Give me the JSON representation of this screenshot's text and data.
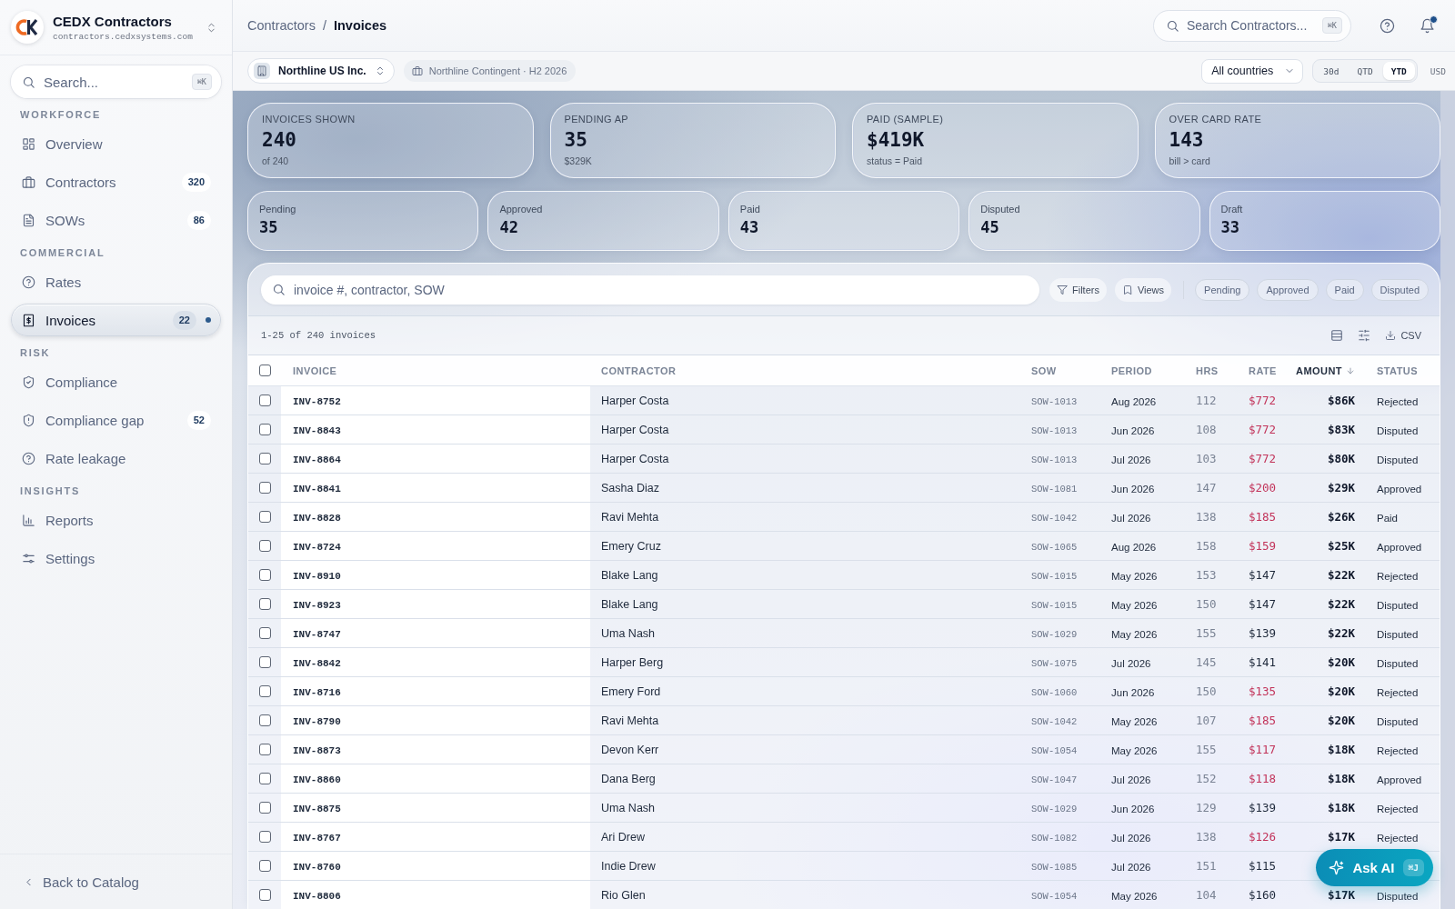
{
  "sidebar": {
    "brand": {
      "name": "CEDX Contractors",
      "domain": "contractors.cedxsystems.com"
    },
    "search": {
      "placeholder": "Search...",
      "shortcut": "⌘K"
    },
    "sections": [
      {
        "label": "WORKFORCE",
        "items": [
          {
            "label": "Overview",
            "selected": false
          },
          {
            "label": "Contractors",
            "badge": "320",
            "selected": false
          },
          {
            "label": "SOWs",
            "badge": "86",
            "selected": false
          }
        ]
      },
      {
        "label": "COMMERCIAL",
        "items": [
          {
            "label": "Rates",
            "selected": false
          },
          {
            "label": "Invoices",
            "badge": "22",
            "selected": true
          }
        ]
      },
      {
        "label": "RISK",
        "items": [
          {
            "label": "Compliance",
            "selected": false
          },
          {
            "label": "Compliance gap",
            "badge": "52",
            "selected": false
          },
          {
            "label": "Rate leakage",
            "selected": false
          }
        ]
      },
      {
        "label": "INSIGHTS",
        "items": [
          {
            "label": "Reports",
            "selected": false
          },
          {
            "label": "Settings",
            "selected": false
          }
        ]
      }
    ],
    "back_link": "Back to Catalog"
  },
  "topbar": {
    "breadcrumb": [
      {
        "label": "Contractors",
        "current": false
      },
      {
        "label": "Invoices",
        "current": true
      }
    ],
    "separator": "/",
    "search": {
      "placeholder": "Search Contractors...",
      "shortcut": "⌘K"
    },
    "notifications": {
      "unread": true
    }
  },
  "filter_bar": {
    "entity": "Northline US Inc.",
    "program": "Northline Contingent · H2 2026",
    "country": "All countries",
    "periods": [
      {
        "label": "30d",
        "selected": false
      },
      {
        "label": "QTD",
        "selected": false
      },
      {
        "label": "YTD",
        "selected": true
      }
    ],
    "currency": "USD"
  },
  "kpis": [
    {
      "label": "INVOICES SHOWN",
      "value": "240",
      "sub": "of 240"
    },
    {
      "label": "PENDING AP",
      "value": "35",
      "sub": "$329K"
    },
    {
      "label": "PAID (SAMPLE)",
      "value": "$419K",
      "sub": "status = Paid"
    },
    {
      "label": "OVER CARD RATE",
      "value": "143",
      "sub": "bill > card"
    }
  ],
  "status_counts": [
    {
      "label": "Pending",
      "value": "35"
    },
    {
      "label": "Approved",
      "value": "42"
    },
    {
      "label": "Paid",
      "value": "43"
    },
    {
      "label": "Disputed",
      "value": "45"
    },
    {
      "label": "Draft",
      "value": "33"
    }
  ],
  "invoices": {
    "search": {
      "placeholder": "invoice #, contractor, SOW"
    },
    "filters_button": "Filters",
    "views_button": "Views",
    "chips": [
      {
        "label": "Pending",
        "selected": false
      },
      {
        "label": "Approved",
        "selected": false
      },
      {
        "label": "Paid",
        "selected": false
      },
      {
        "label": "Disputed",
        "selected": false
      }
    ],
    "summary": "1-25 of 240 invoices",
    "export_button": "CSV",
    "table": {
      "select_all_checked": false,
      "columns": [
        {
          "label": "INVOICE",
          "sorted": false
        },
        {
          "label": "CONTRACTOR",
          "sorted": false
        },
        {
          "label": "SOW",
          "sorted": false
        },
        {
          "label": "PERIOD",
          "sorted": false
        },
        {
          "label": "HRS",
          "sorted": false
        },
        {
          "label": "RATE",
          "sorted": false
        },
        {
          "label": "AMOUNT",
          "sorted": true
        },
        {
          "label": "STATUS",
          "sorted": false
        }
      ],
      "rows": [
        {
          "checked": false,
          "invoice": "INV-8752",
          "contractor": "Harper Costa",
          "sow": "SOW-1013",
          "period": "Aug 2026",
          "hrs": "112",
          "rate": "$772",
          "over_rate": true,
          "amount": "$86K",
          "status": "Rejected"
        },
        {
          "checked": false,
          "invoice": "INV-8843",
          "contractor": "Harper Costa",
          "sow": "SOW-1013",
          "period": "Jun 2026",
          "hrs": "108",
          "rate": "$772",
          "over_rate": true,
          "amount": "$83K",
          "status": "Disputed"
        },
        {
          "checked": false,
          "invoice": "INV-8864",
          "contractor": "Harper Costa",
          "sow": "SOW-1013",
          "period": "Jul 2026",
          "hrs": "103",
          "rate": "$772",
          "over_rate": true,
          "amount": "$80K",
          "status": "Disputed"
        },
        {
          "checked": false,
          "invoice": "INV-8841",
          "contractor": "Sasha Diaz",
          "sow": "SOW-1081",
          "period": "Jun 2026",
          "hrs": "147",
          "rate": "$200",
          "over_rate": true,
          "amount": "$29K",
          "status": "Approved"
        },
        {
          "checked": false,
          "invoice": "INV-8828",
          "contractor": "Ravi Mehta",
          "sow": "SOW-1042",
          "period": "Jul 2026",
          "hrs": "138",
          "rate": "$185",
          "over_rate": true,
          "amount": "$26K",
          "status": "Paid"
        },
        {
          "checked": false,
          "invoice": "INV-8724",
          "contractor": "Emery Cruz",
          "sow": "SOW-1065",
          "period": "Aug 2026",
          "hrs": "158",
          "rate": "$159",
          "over_rate": true,
          "amount": "$25K",
          "status": "Approved"
        },
        {
          "checked": false,
          "invoice": "INV-8910",
          "contractor": "Blake Lang",
          "sow": "SOW-1015",
          "period": "May 2026",
          "hrs": "153",
          "rate": "$147",
          "over_rate": false,
          "amount": "$22K",
          "status": "Rejected"
        },
        {
          "checked": false,
          "invoice": "INV-8923",
          "contractor": "Blake Lang",
          "sow": "SOW-1015",
          "period": "May 2026",
          "hrs": "150",
          "rate": "$147",
          "over_rate": false,
          "amount": "$22K",
          "status": "Disputed"
        },
        {
          "checked": false,
          "invoice": "INV-8747",
          "contractor": "Uma Nash",
          "sow": "SOW-1029",
          "period": "May 2026",
          "hrs": "155",
          "rate": "$139",
          "over_rate": false,
          "amount": "$22K",
          "status": "Disputed"
        },
        {
          "checked": false,
          "invoice": "INV-8842",
          "contractor": "Harper Berg",
          "sow": "SOW-1075",
          "period": "Jul 2026",
          "hrs": "145",
          "rate": "$141",
          "over_rate": false,
          "amount": "$20K",
          "status": "Disputed"
        },
        {
          "checked": false,
          "invoice": "INV-8716",
          "contractor": "Emery Ford",
          "sow": "SOW-1060",
          "period": "Jun 2026",
          "hrs": "150",
          "rate": "$135",
          "over_rate": true,
          "amount": "$20K",
          "status": "Rejected"
        },
        {
          "checked": false,
          "invoice": "INV-8790",
          "contractor": "Ravi Mehta",
          "sow": "SOW-1042",
          "period": "May 2026",
          "hrs": "107",
          "rate": "$185",
          "over_rate": true,
          "amount": "$20K",
          "status": "Disputed"
        },
        {
          "checked": false,
          "invoice": "INV-8873",
          "contractor": "Devon Kerr",
          "sow": "SOW-1054",
          "period": "May 2026",
          "hrs": "155",
          "rate": "$117",
          "over_rate": true,
          "amount": "$18K",
          "status": "Rejected"
        },
        {
          "checked": false,
          "invoice": "INV-8860",
          "contractor": "Dana Berg",
          "sow": "SOW-1047",
          "period": "Jul 2026",
          "hrs": "152",
          "rate": "$118",
          "over_rate": true,
          "amount": "$18K",
          "status": "Approved"
        },
        {
          "checked": false,
          "invoice": "INV-8875",
          "contractor": "Uma Nash",
          "sow": "SOW-1029",
          "period": "Jun 2026",
          "hrs": "129",
          "rate": "$139",
          "over_rate": false,
          "amount": "$18K",
          "status": "Rejected"
        },
        {
          "checked": false,
          "invoice": "INV-8767",
          "contractor": "Ari Drew",
          "sow": "SOW-1082",
          "period": "Jul 2026",
          "hrs": "138",
          "rate": "$126",
          "over_rate": true,
          "amount": "$17K",
          "status": "Rejected"
        },
        {
          "checked": false,
          "invoice": "INV-8760",
          "contractor": "Indie Drew",
          "sow": "SOW-1085",
          "period": "Jul 2026",
          "hrs": "151",
          "rate": "$115",
          "over_rate": false
        },
        {
          "checked": false,
          "invoice": "INV-8806",
          "contractor": "Rio Glen",
          "sow": "SOW-1054",
          "period": "May 2026",
          "hrs": "104",
          "rate": "$160",
          "over_rate": false,
          "amount": "$17K",
          "status": "Disputed"
        }
      ]
    }
  },
  "ask_ai": {
    "label": "Ask AI",
    "shortcut": "⌘J"
  }
}
